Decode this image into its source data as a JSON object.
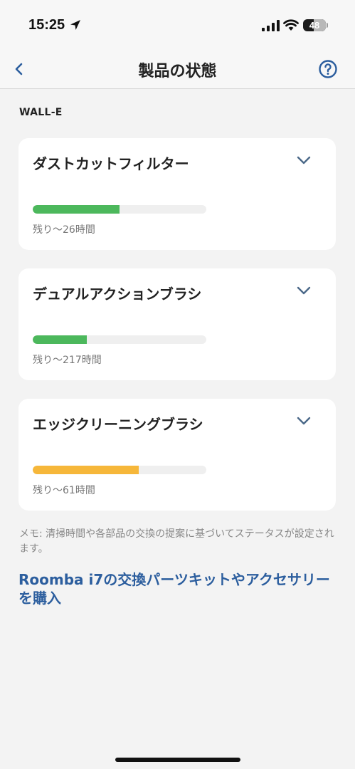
{
  "status_bar": {
    "time": "15:25",
    "battery_level": "48",
    "battery_fraction": 0.48
  },
  "nav": {
    "title": "製品の状態",
    "back_icon": "chevron-left-icon",
    "help_icon": "question-circle-icon"
  },
  "device": {
    "name": "WALL-E"
  },
  "items": [
    {
      "name": "ダストカットフィルター",
      "remaining": "残り〜26時間",
      "progress": 0.5,
      "color": "#4cb85c"
    },
    {
      "name": "デュアルアクションブラシ",
      "remaining": "残り〜217時間",
      "progress": 0.31,
      "color": "#4cb85c"
    },
    {
      "name": "エッジクリーニングブラシ",
      "remaining": "残り〜61時間",
      "progress": 0.61,
      "color": "#f6b73a"
    }
  ],
  "note": "メモ: 清掃時間や各部品の交換の提案に基づいてステータスが設定されます。",
  "shop_link": "Roomba i7の交換パーツキットやアクセサリーを購入",
  "colors": {
    "accent": "#2c5e9e",
    "good": "#4cb85c",
    "warning": "#f6b73a"
  }
}
